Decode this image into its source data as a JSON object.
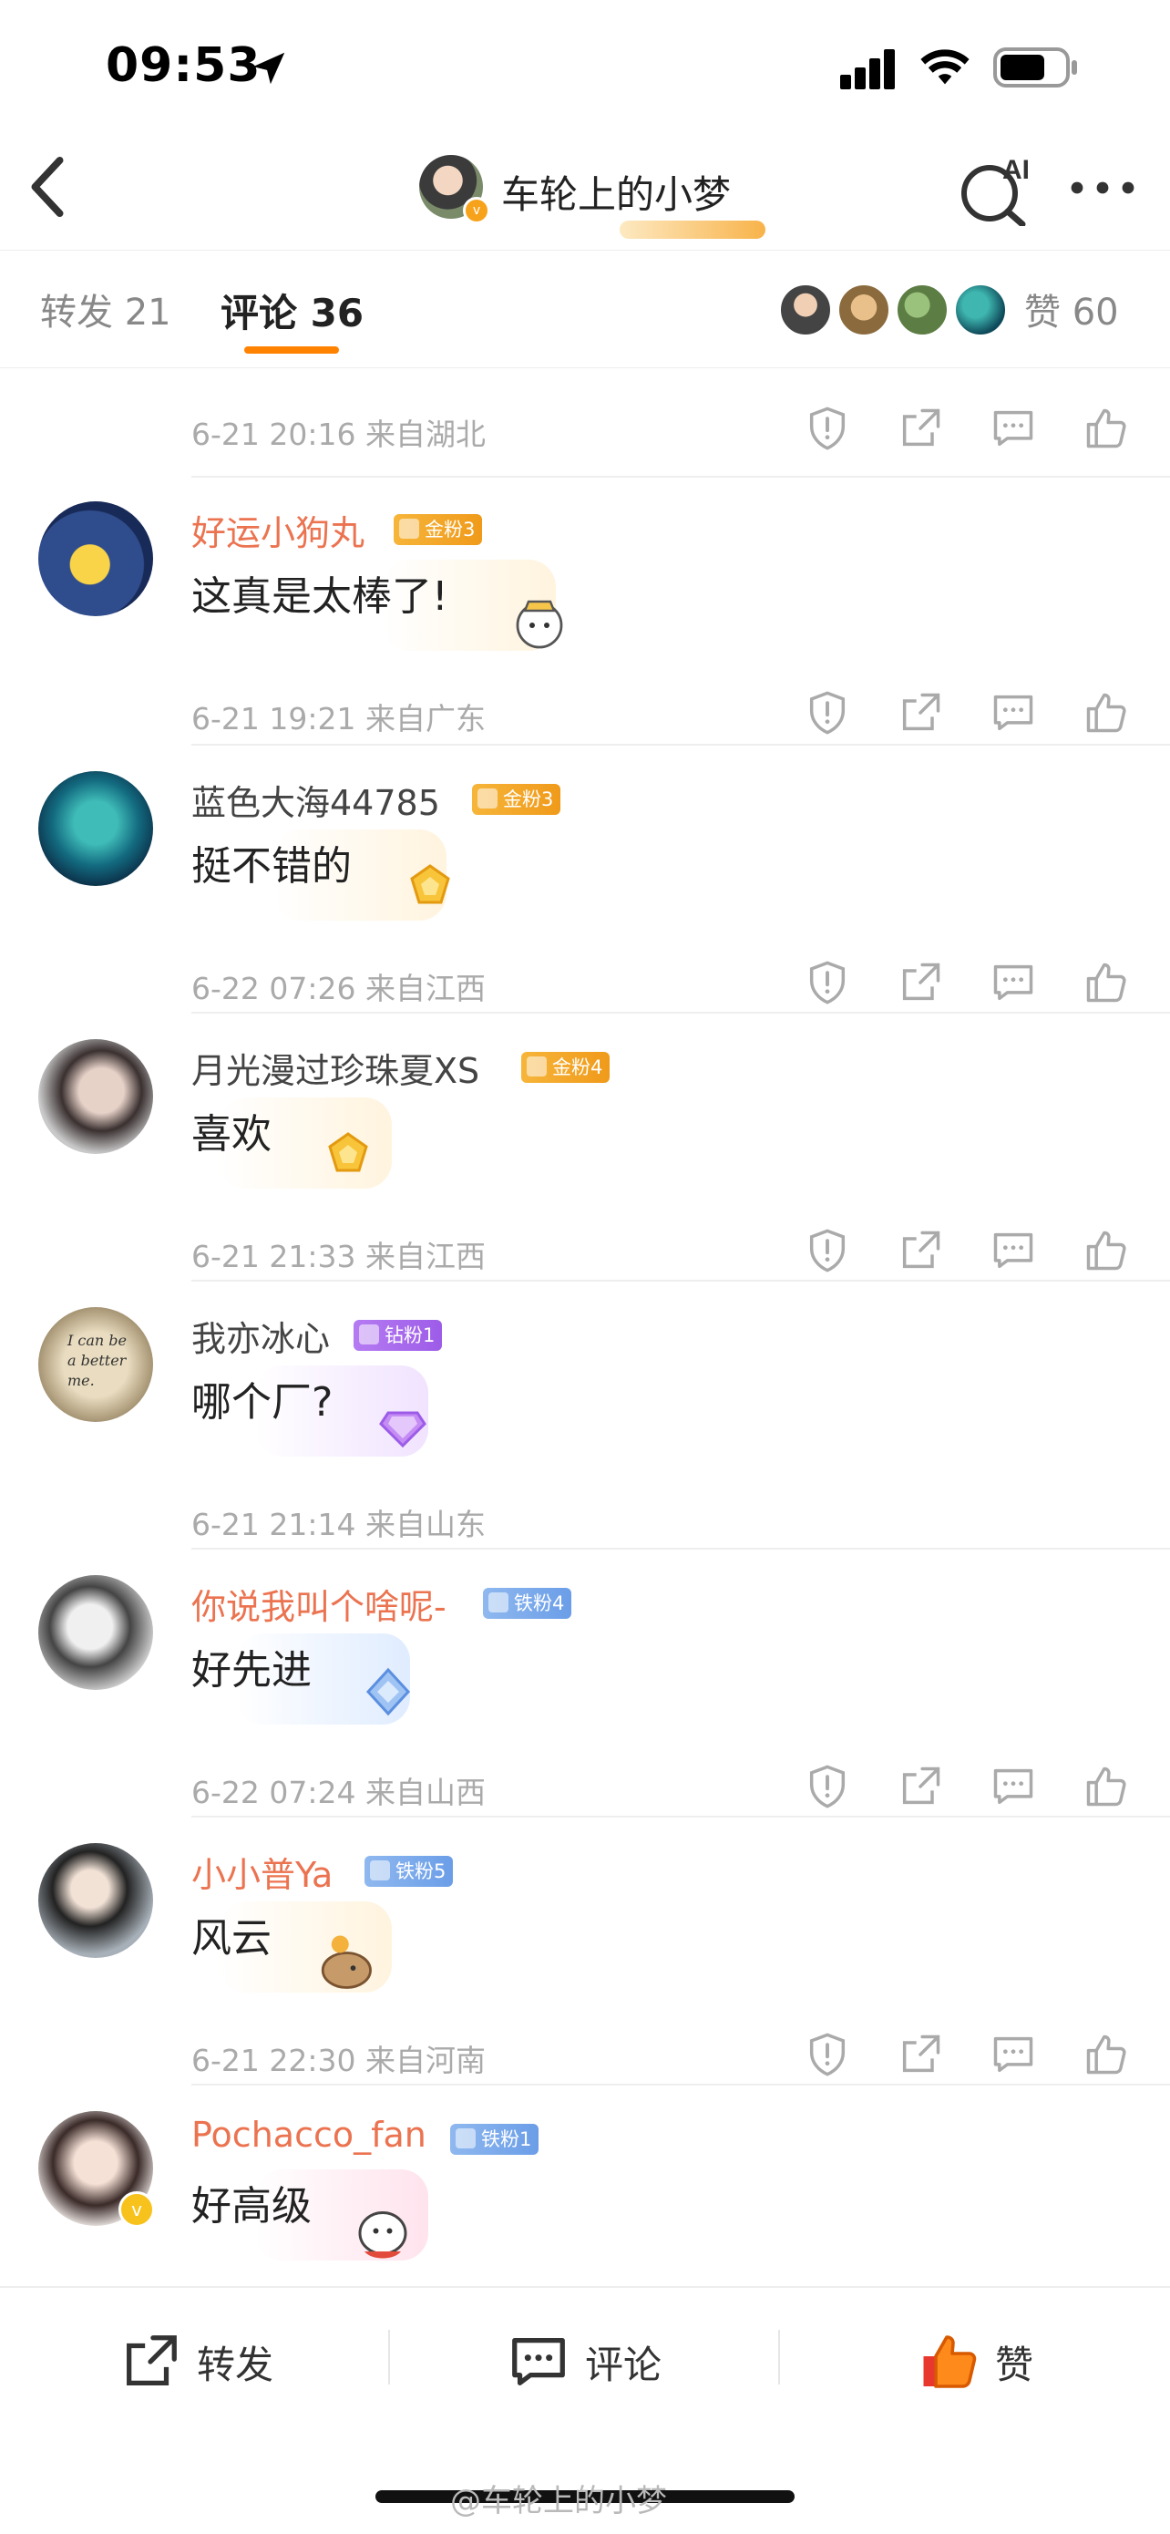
{
  "status_bar": {
    "time": "09:53"
  },
  "header": {
    "title": "车轮上的小梦",
    "ai_label": "AI"
  },
  "tabs": {
    "repost": "转发 21",
    "comment": "评论 36",
    "likes": "赞 60"
  },
  "comments": [
    {
      "meta": "6-21 20:16  来自湖北"
    },
    {
      "user": "好运小狗丸",
      "fan_badge": "金粉3",
      "text": "这真是太棒了!",
      "meta": "6-21 19:21  来自广东"
    },
    {
      "user": "蓝色大海44785",
      "fan_badge": "金粉3",
      "text": "挺不错的",
      "meta": "6-22 07:26  来自江西"
    },
    {
      "user": "月光漫过珍珠夏XS",
      "fan_badge": "金粉4",
      "text": "喜欢",
      "meta": "6-21 21:33  来自江西"
    },
    {
      "user": "我亦冰心",
      "fan_badge": "钻粉1",
      "text": "哪个厂?",
      "meta": "6-21 21:14  来自山东"
    },
    {
      "user": "你说我叫个啥呢-",
      "fan_badge": "铁粉4",
      "text": "好先进",
      "meta": "6-22 07:24  来自山西"
    },
    {
      "user": "小小普Ya",
      "fan_badge": "铁粉5",
      "text": "风云",
      "meta": "6-21 22:30  来自河南"
    },
    {
      "user": "Pochacco_fan",
      "fan_badge": "铁粉1",
      "text": "好高级"
    }
  ],
  "avatar_text": {
    "line1": "I can be",
    "line2": "a better",
    "line3": "me."
  },
  "bottom_bar": {
    "repost": "转发",
    "comment": "评论",
    "like": "赞"
  },
  "watermark": "@车轮上的小梦",
  "colors": {
    "accent": "#ff8200",
    "username_orange": "#eb7350",
    "meta_gray": "#aaaaaa"
  },
  "icons": [
    "back-icon",
    "ai-search-icon",
    "more-icon",
    "report-icon",
    "share-icon",
    "comment-icon",
    "like-icon"
  ]
}
